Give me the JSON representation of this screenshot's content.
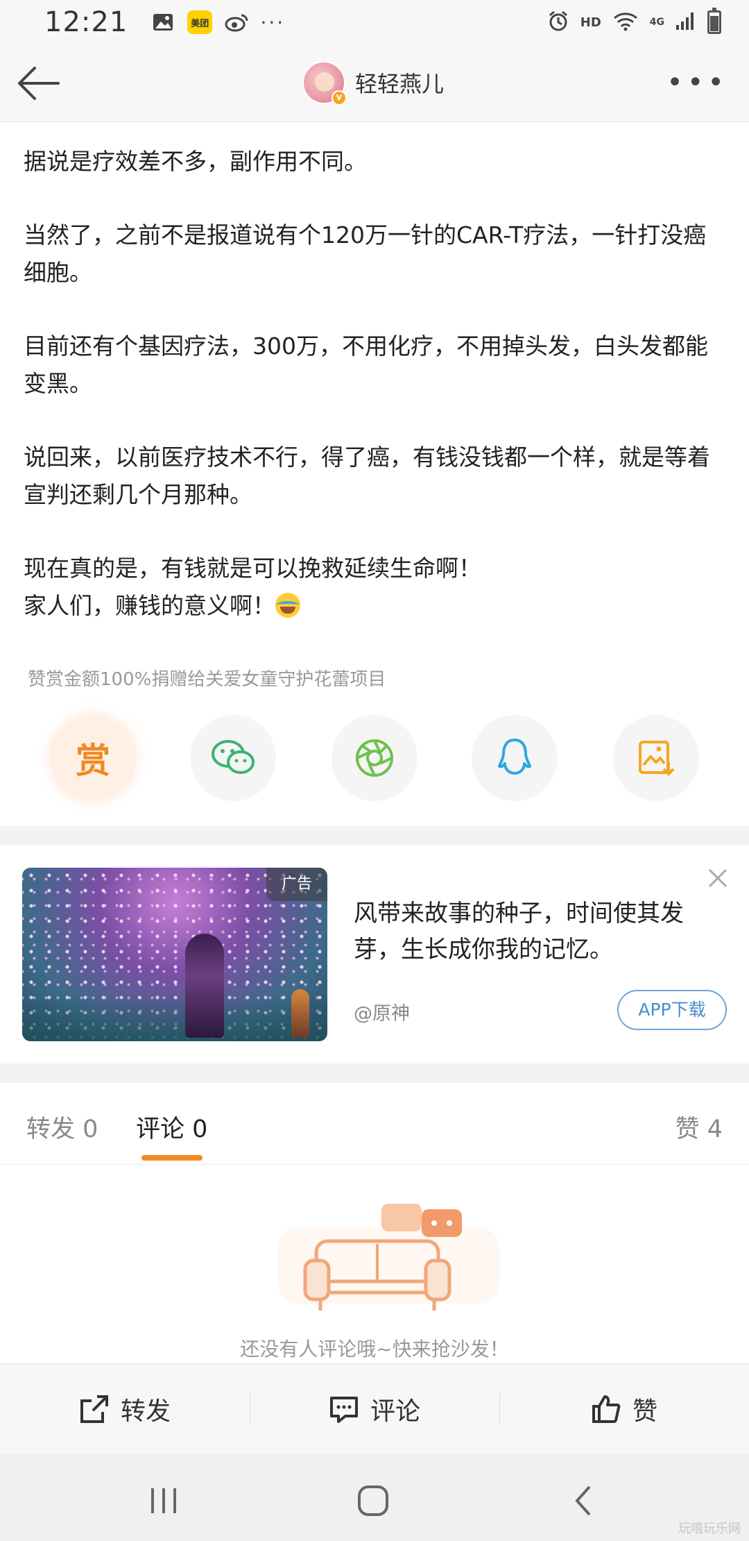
{
  "status_bar": {
    "time": "12:21",
    "notification_icons": [
      "gallery-icon",
      "meituan-icon",
      "weibo-icon"
    ],
    "meituan_label": "美团",
    "more": "···",
    "hd_label": "HD",
    "network_label": "4G"
  },
  "header": {
    "user_name": "轻轻燕儿",
    "verified_badge": "v"
  },
  "post": {
    "paragraphs": [
      "据说是疗效差不多，副作用不同。",
      "当然了，之前不是报道说有个120万一针的CAR-T疗法，一针打没癌细胞。",
      "目前还有个基因疗法，300万，不用化疗，不用掉头发，白头发都能变黑。",
      "说回来，以前医疗技术不行，得了癌，有钱没钱都一个样，就是等着宣判还剩几个月那种。",
      "现在真的是，有钱就是可以挽救延续生命啊！",
      "家人们，赚钱的意义啊！"
    ]
  },
  "reward": {
    "note": "赞赏金额100%捐赠给关爱女童守护花蕾项目",
    "reward_label": "赏",
    "share_icons": [
      "reward-icon",
      "wechat-icon",
      "moments-icon",
      "qq-icon",
      "save-image-icon"
    ]
  },
  "ad": {
    "tag": "广告",
    "title": "风带来故事的种子，时间使其发芽，生长成你我的记忆。",
    "source": "@原神",
    "download_label": "APP下载"
  },
  "tabs": {
    "repost": "转发 0",
    "comment": "评论 0",
    "like": "赞 4"
  },
  "empty_state": {
    "text": "还没有人评论哦~快来抢沙发！"
  },
  "toolbar": {
    "repost": "转发",
    "comment": "评论",
    "like": "赞"
  },
  "watermark": "玩嘻玩乐网",
  "colors": {
    "accent": "#f08a24",
    "link": "#4a8ac8",
    "wechat": "#3cb371",
    "moments": "#6cc24a",
    "qq": "#2aa8e0",
    "save": "#f5a623"
  }
}
